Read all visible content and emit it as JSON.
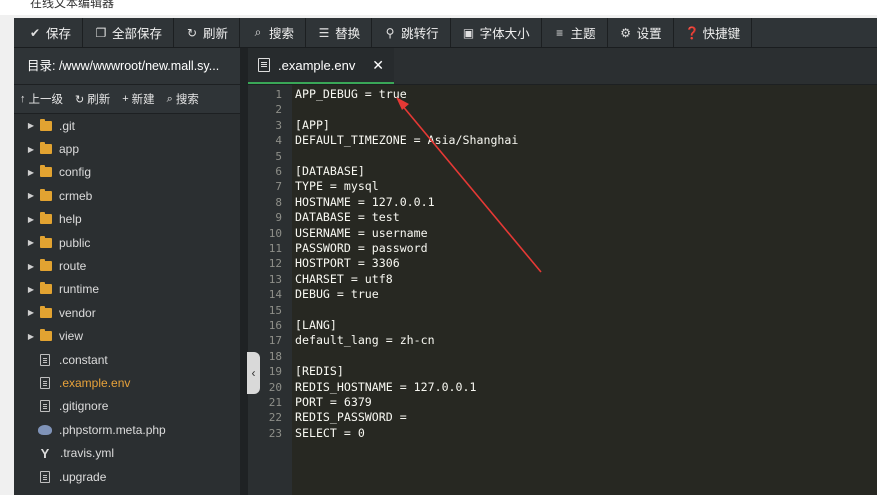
{
  "window": {
    "title": "在线文本编辑器"
  },
  "toolbar": {
    "buttons": [
      {
        "label": "保存",
        "icon": "check-icon"
      },
      {
        "label": "全部保存",
        "icon": "copy-icon"
      },
      {
        "label": "刷新",
        "icon": "refresh-icon"
      },
      {
        "label": "搜索",
        "icon": "search-icon"
      },
      {
        "label": "替换",
        "icon": "replace-icon"
      },
      {
        "label": "跳转行",
        "icon": "goto-line-icon"
      },
      {
        "label": "字体大小",
        "icon": "font-size-icon"
      },
      {
        "label": "主题",
        "icon": "menu-icon"
      },
      {
        "label": "设置",
        "icon": "gear-icon"
      },
      {
        "label": "快捷键",
        "icon": "help-icon"
      }
    ]
  },
  "sidebar": {
    "path_label": "目录: /www/wwwroot/new.mall.sy...",
    "actions": [
      {
        "label": "上一级",
        "icon": "arrow-up-icon"
      },
      {
        "label": "刷新",
        "icon": "refresh-icon"
      },
      {
        "label": "新建",
        "icon": "plus-icon"
      },
      {
        "label": "搜索",
        "icon": "search-icon"
      }
    ],
    "tree": [
      {
        "name": ".git",
        "type": "folder"
      },
      {
        "name": "app",
        "type": "folder"
      },
      {
        "name": "config",
        "type": "folder"
      },
      {
        "name": "crmeb",
        "type": "folder"
      },
      {
        "name": "help",
        "type": "folder"
      },
      {
        "name": "public",
        "type": "folder"
      },
      {
        "name": "route",
        "type": "folder"
      },
      {
        "name": "runtime",
        "type": "folder"
      },
      {
        "name": "vendor",
        "type": "folder"
      },
      {
        "name": "view",
        "type": "folder"
      },
      {
        "name": ".constant",
        "type": "file"
      },
      {
        "name": ".example.env",
        "type": "file",
        "active": true
      },
      {
        "name": ".gitignore",
        "type": "file"
      },
      {
        "name": ".phpstorm.meta.php",
        "type": "php"
      },
      {
        "name": ".travis.yml",
        "type": "yml"
      },
      {
        "name": ".upgrade",
        "type": "file"
      }
    ]
  },
  "editor": {
    "tab_label": ".example.env",
    "tab_close": "✕",
    "lines": [
      "APP_DEBUG = true",
      "",
      "[APP]",
      "DEFAULT_TIMEZONE = Asia/Shanghai",
      "",
      "[DATABASE]",
      "TYPE = mysql",
      "HOSTNAME = 127.0.0.1",
      "DATABASE = test",
      "USERNAME = username",
      "PASSWORD = password",
      "HOSTPORT = 3306",
      "CHARSET = utf8",
      "DEBUG = true",
      "",
      "[LANG]",
      "default_lang = zh-cn",
      "",
      "[REDIS]",
      "REDIS_HOSTNAME = 127.0.0.1",
      "PORT = 6379",
      "REDIS_PASSWORD =",
      "SELECT = 0"
    ]
  },
  "colors": {
    "toolbar_bg": "#2f3437",
    "editor_bg": "#272822",
    "active_file": "#e8a23a",
    "tab_accent": "#3aa757",
    "annotation_arrow": "#e53935"
  }
}
